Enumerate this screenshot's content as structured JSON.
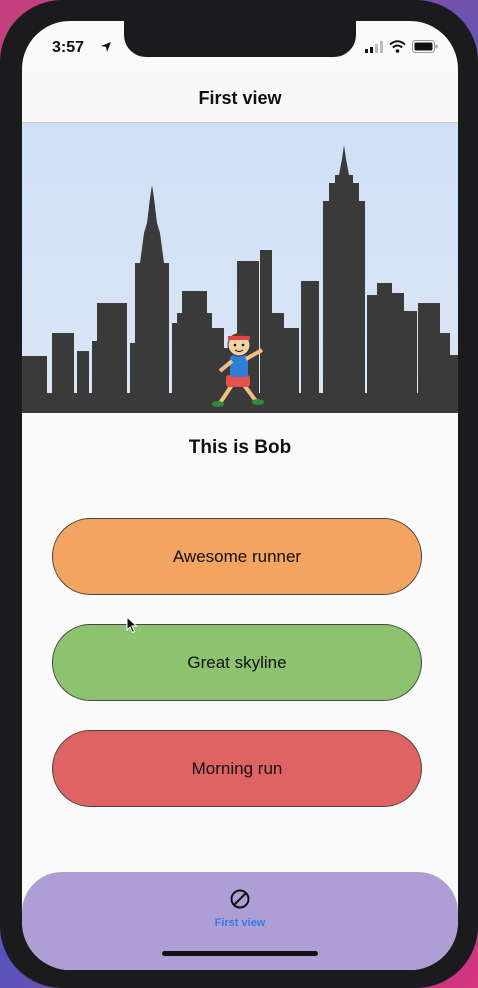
{
  "status_bar": {
    "time": "3:57"
  },
  "navbar": {
    "title": "First view"
  },
  "hero": {
    "subject": "This is Bob"
  },
  "buttons": [
    {
      "label": "Awesome runner",
      "color": "#f3a461"
    },
    {
      "label": "Great skyline",
      "color": "#8dc26f"
    },
    {
      "label": "Morning run",
      "color": "#e06363"
    }
  ],
  "tabbar": {
    "color": "#ad9fd5",
    "accent": "#3a78e0",
    "items": [
      {
        "label": "First view",
        "icon": "circle-slash-icon"
      }
    ]
  }
}
